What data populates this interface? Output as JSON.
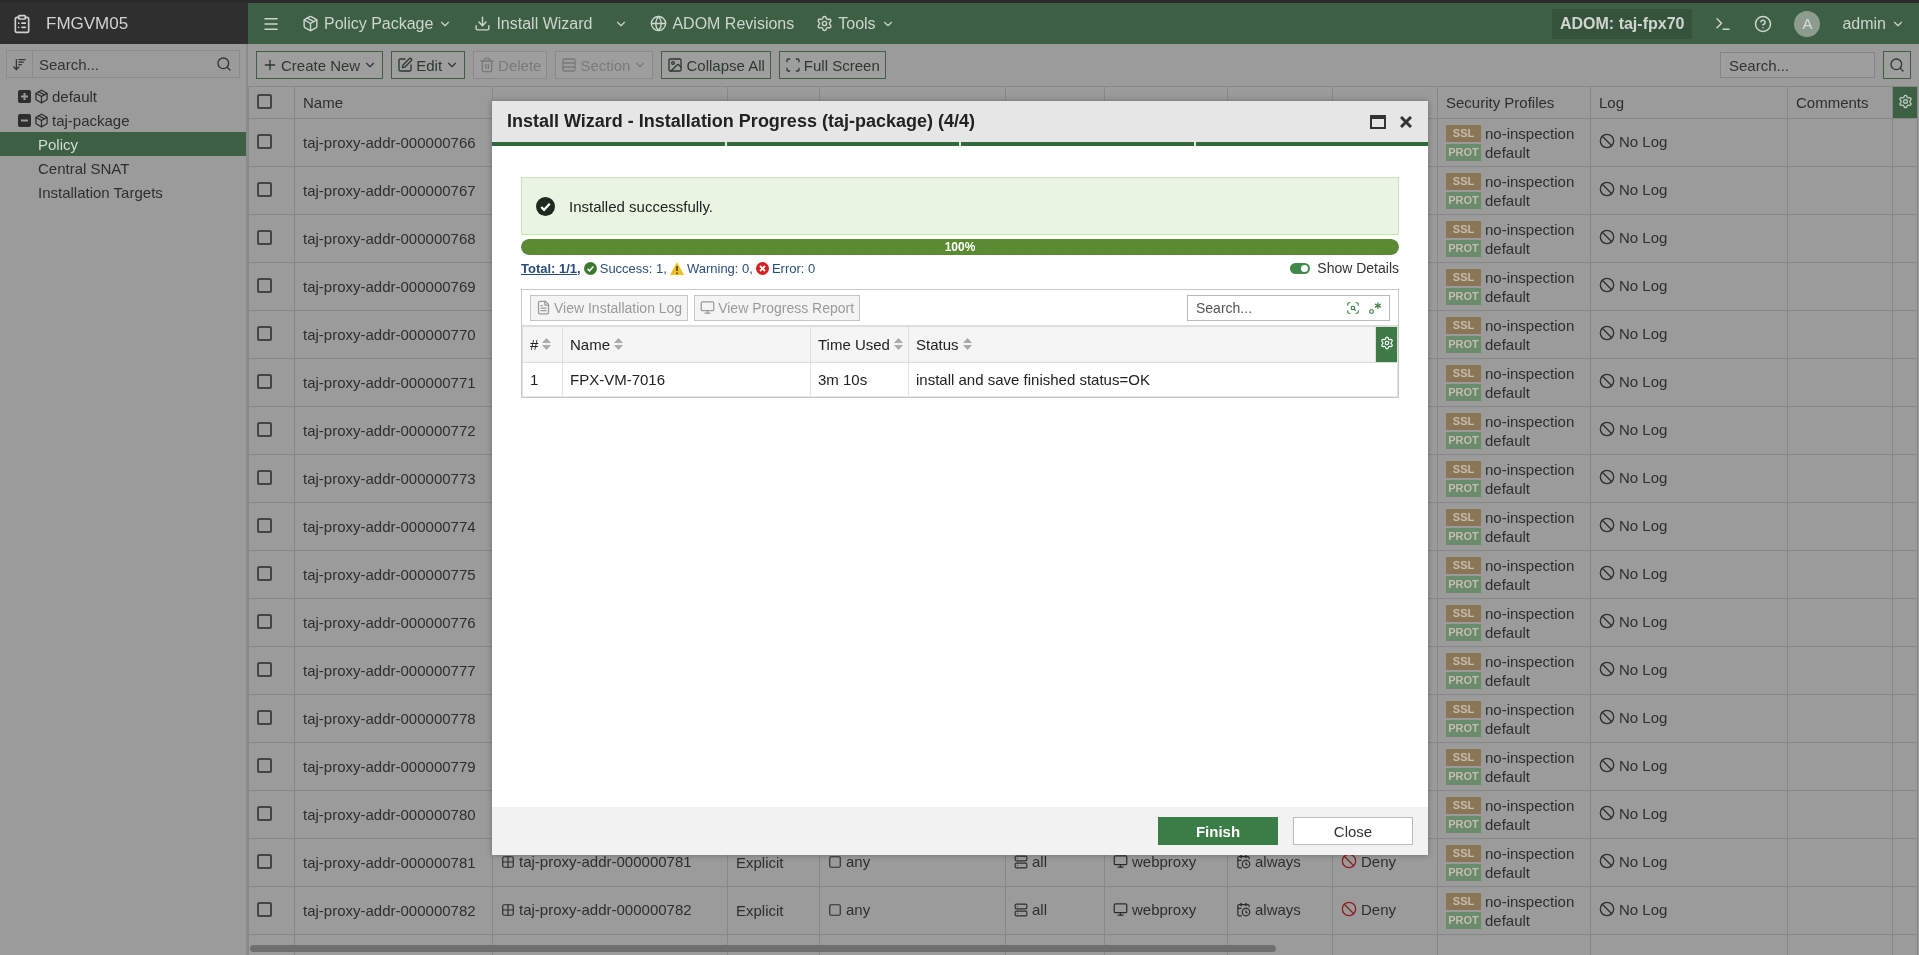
{
  "app": {
    "title": "FMGVM05"
  },
  "sidebar": {
    "search": {
      "placeholder": "Search..."
    },
    "tree": [
      {
        "label": "default",
        "expanded": false
      },
      {
        "label": "taj-package",
        "expanded": true,
        "children": [
          {
            "label": "Policy",
            "selected": true
          },
          {
            "label": "Central SNAT",
            "selected": false
          },
          {
            "label": "Installation Targets",
            "selected": false
          }
        ]
      }
    ]
  },
  "top_menu": [
    {
      "label": "Policy Package",
      "kind": "menu"
    },
    {
      "label": "Install Wizard",
      "kind": "split"
    },
    {
      "label": "ADOM Revisions",
      "kind": "plain"
    },
    {
      "label": "Tools",
      "kind": "menu"
    }
  ],
  "adom": "ADOM: taj-fpx70",
  "user": {
    "avatar": "A",
    "name": "admin"
  },
  "toolbar": {
    "buttons": [
      {
        "label": "Create New",
        "disabled": false,
        "has_menu": true
      },
      {
        "label": "Edit",
        "disabled": false,
        "has_menu": true
      },
      {
        "label": "Delete",
        "disabled": true,
        "has_menu": false
      },
      {
        "label": "Section",
        "disabled": true,
        "has_menu": true
      },
      {
        "label": "Collapse All",
        "disabled": false,
        "has_menu": false
      },
      {
        "label": "Full Screen",
        "disabled": false,
        "has_menu": false
      }
    ],
    "search": {
      "placeholder": "Search..."
    }
  },
  "policy_table": {
    "select_all": {
      "checked": false
    },
    "headers": {
      "name": "Name",
      "security_profiles": "Security Profiles",
      "log": "Log",
      "comments": "Comments"
    },
    "rows": [
      {
        "checked": false,
        "name": "taj-proxy-addr-000000766",
        "security_profiles": [
          {
            "tag": "SSL",
            "color": "#8a7556",
            "value": "no-inspection"
          },
          {
            "tag": "PROT",
            "color": "#6b8b6d",
            "value": "default"
          }
        ],
        "log": "No Log"
      },
      {
        "checked": false,
        "name": "taj-proxy-addr-000000767",
        "security_profiles": [
          {
            "tag": "SSL",
            "color": "#8a7556",
            "value": "no-inspection"
          },
          {
            "tag": "PROT",
            "color": "#6b8b6d",
            "value": "default"
          }
        ],
        "log": "No Log"
      },
      {
        "checked": false,
        "name": "taj-proxy-addr-000000768",
        "security_profiles": [
          {
            "tag": "SSL",
            "color": "#8a7556",
            "value": "no-inspection"
          },
          {
            "tag": "PROT",
            "color": "#6b8b6d",
            "value": "default"
          }
        ],
        "log": "No Log"
      },
      {
        "checked": false,
        "name": "taj-proxy-addr-000000769",
        "security_profiles": [
          {
            "tag": "SSL",
            "color": "#8a7556",
            "value": "no-inspection"
          },
          {
            "tag": "PROT",
            "color": "#6b8b6d",
            "value": "default"
          }
        ],
        "log": "No Log"
      },
      {
        "checked": false,
        "name": "taj-proxy-addr-000000770",
        "security_profiles": [
          {
            "tag": "SSL",
            "color": "#8a7556",
            "value": "no-inspection"
          },
          {
            "tag": "PROT",
            "color": "#6b8b6d",
            "value": "default"
          }
        ],
        "log": "No Log"
      },
      {
        "checked": false,
        "name": "taj-proxy-addr-000000771",
        "security_profiles": [
          {
            "tag": "SSL",
            "color": "#8a7556",
            "value": "no-inspection"
          },
          {
            "tag": "PROT",
            "color": "#6b8b6d",
            "value": "default"
          }
        ],
        "log": "No Log"
      },
      {
        "checked": false,
        "name": "taj-proxy-addr-000000772",
        "security_profiles": [
          {
            "tag": "SSL",
            "color": "#8a7556",
            "value": "no-inspection"
          },
          {
            "tag": "PROT",
            "color": "#6b8b6d",
            "value": "default"
          }
        ],
        "log": "No Log"
      },
      {
        "checked": false,
        "name": "taj-proxy-addr-000000773",
        "security_profiles": [
          {
            "tag": "SSL",
            "color": "#8a7556",
            "value": "no-inspection"
          },
          {
            "tag": "PROT",
            "color": "#6b8b6d",
            "value": "default"
          }
        ],
        "log": "No Log"
      },
      {
        "checked": false,
        "name": "taj-proxy-addr-000000774",
        "security_profiles": [
          {
            "tag": "SSL",
            "color": "#8a7556",
            "value": "no-inspection"
          },
          {
            "tag": "PROT",
            "color": "#6b8b6d",
            "value": "default"
          }
        ],
        "log": "No Log"
      },
      {
        "checked": false,
        "name": "taj-proxy-addr-000000775",
        "security_profiles": [
          {
            "tag": "SSL",
            "color": "#8a7556",
            "value": "no-inspection"
          },
          {
            "tag": "PROT",
            "color": "#6b8b6d",
            "value": "default"
          }
        ],
        "log": "No Log"
      },
      {
        "checked": false,
        "name": "taj-proxy-addr-000000776",
        "security_profiles": [
          {
            "tag": "SSL",
            "color": "#8a7556",
            "value": "no-inspection"
          },
          {
            "tag": "PROT",
            "color": "#6b8b6d",
            "value": "default"
          }
        ],
        "log": "No Log"
      },
      {
        "checked": false,
        "name": "taj-proxy-addr-000000777",
        "security_profiles": [
          {
            "tag": "SSL",
            "color": "#8a7556",
            "value": "no-inspection"
          },
          {
            "tag": "PROT",
            "color": "#6b8b6d",
            "value": "default"
          }
        ],
        "log": "No Log"
      },
      {
        "checked": false,
        "name": "taj-proxy-addr-000000778",
        "security_profiles": [
          {
            "tag": "SSL",
            "color": "#8a7556",
            "value": "no-inspection"
          },
          {
            "tag": "PROT",
            "color": "#6b8b6d",
            "value": "default"
          }
        ],
        "log": "No Log"
      },
      {
        "checked": false,
        "name": "taj-proxy-addr-000000779",
        "security_profiles": [
          {
            "tag": "SSL",
            "color": "#8a7556",
            "value": "no-inspection"
          },
          {
            "tag": "PROT",
            "color": "#6b8b6d",
            "value": "default"
          }
        ],
        "log": "No Log"
      },
      {
        "checked": false,
        "name": "taj-proxy-addr-000000780",
        "security_profiles": [
          {
            "tag": "SSL",
            "color": "#8a7556",
            "value": "no-inspection"
          },
          {
            "tag": "PROT",
            "color": "#6b8b6d",
            "value": "default"
          }
        ],
        "log": "No Log"
      },
      {
        "checked": false,
        "name": "taj-proxy-addr-000000781",
        "destination": "taj-proxy-addr-000000781",
        "type": "Explicit",
        "destination_interface": "any",
        "source": "all",
        "service": "webproxy",
        "schedule": "always",
        "action": "Deny",
        "security_profiles": [
          {
            "tag": "SSL",
            "color": "#8a7556",
            "value": "no-inspection"
          },
          {
            "tag": "PROT",
            "color": "#6b8b6d",
            "value": "default"
          }
        ],
        "log": "No Log"
      },
      {
        "checked": false,
        "name": "taj-proxy-addr-000000782",
        "destination": "taj-proxy-addr-000000782",
        "type": "Explicit",
        "destination_interface": "any",
        "source": "all",
        "service": "webproxy",
        "schedule": "always",
        "action": "Deny",
        "security_profiles": [
          {
            "tag": "SSL",
            "color": "#8a7556",
            "value": "no-inspection"
          },
          {
            "tag": "PROT",
            "color": "#6b8b6d",
            "value": "default"
          }
        ],
        "log": "No Log"
      }
    ]
  },
  "dialog": {
    "title": "Install Wizard - Installation Progress (taj-package) (4/4)",
    "steps": [
      {
        "complete": true
      },
      {
        "complete": true
      },
      {
        "complete": true
      },
      {
        "complete": true
      }
    ],
    "message": "Installed successfully.",
    "progress": {
      "level": 1,
      "label": "100%"
    },
    "summary": {
      "total": "Total: 1/1,",
      "success": "Success: 1,",
      "warning": "Warning: 0,",
      "error": "Error: 0"
    },
    "show_details": {
      "label": "Show Details",
      "on": true
    },
    "buttons": [
      {
        "label": "View Installation Log",
        "disabled": true
      },
      {
        "label": "View Progress Report",
        "disabled": true
      }
    ],
    "search": {
      "placeholder": "Search..."
    },
    "columns": [
      "#",
      "Name",
      "Time Used",
      "Status"
    ],
    "rows": [
      [
        "1",
        "FPX-VM-7016",
        "3m 10s",
        "install and save finished status=OK"
      ]
    ],
    "footer_buttons": [
      {
        "label": "Finish",
        "kind": "primary"
      },
      {
        "label": "Close",
        "kind": "secondary"
      }
    ]
  }
}
